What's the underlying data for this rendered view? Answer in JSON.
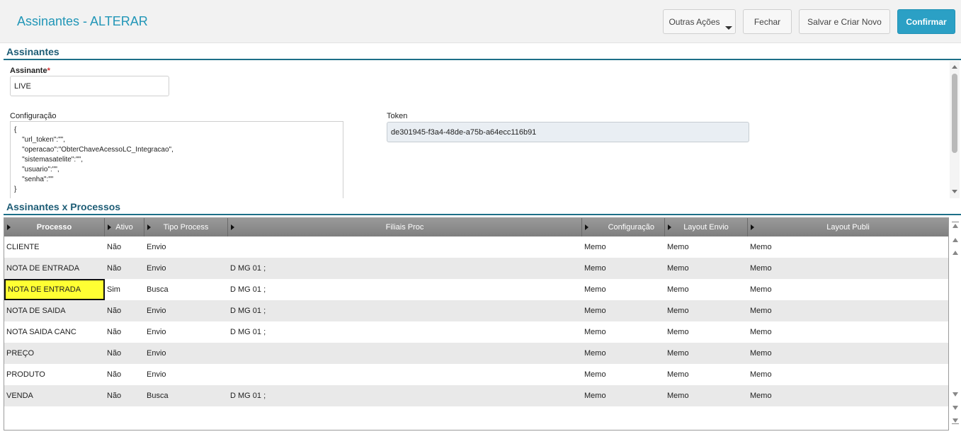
{
  "header": {
    "title": "Assinantes - ALTERAR",
    "buttons": {
      "outras_acoes": "Outras Ações",
      "fechar": "Fechar",
      "salvar_criar_novo": "Salvar e Criar Novo",
      "confirmar": "Confirmar"
    }
  },
  "section_assinantes": {
    "title": "Assinantes",
    "assinante_label": "Assinante",
    "required_mark": "*",
    "assinante_value": "LIVE",
    "configuracao_label": "Configuração",
    "configuracao_value": "{\n    \"url_token\":\"\",\n    \"operacao\":\"ObterChaveAcessoLC_Integracao\",\n    \"sistemasatelite\":\"\",\n    \"usuario\":\"\",\n    \"senha\":\"\"\n}",
    "token_label": "Token",
    "token_value": "de301945-f3a4-48de-a75b-a64ecc116b91"
  },
  "section_processos": {
    "title": "Assinantes x Processos",
    "columns": [
      "Processo",
      "Ativo",
      "Tipo Process",
      "Filiais Proc",
      "Configuração",
      "Layout Envio",
      "Layout Publi"
    ],
    "rows": [
      [
        "CLIENTE",
        "Não",
        "Envio",
        "",
        "Memo",
        "Memo",
        "Memo"
      ],
      [
        "NOTA DE ENTRADA",
        "Não",
        "Envio",
        "D MG 01 ;",
        "Memo",
        "Memo",
        "Memo"
      ],
      [
        "NOTA DE ENTRADA",
        "Sim",
        "Busca",
        "D MG 01 ;",
        "Memo",
        "Memo",
        "Memo"
      ],
      [
        "NOTA DE SAIDA",
        "Não",
        "Envio",
        "D MG 01 ;",
        "Memo",
        "Memo",
        "Memo"
      ],
      [
        "NOTA SAIDA CANC",
        "Não",
        "Envio",
        "D MG 01 ;",
        "Memo",
        "Memo",
        "Memo"
      ],
      [
        "PREÇO",
        "Não",
        "Envio",
        "",
        "Memo",
        "Memo",
        "Memo"
      ],
      [
        "PRODUTO",
        "Não",
        "Envio",
        "",
        "Memo",
        "Memo",
        "Memo"
      ],
      [
        "VENDA",
        "Não",
        "Busca",
        "D MG 01 ;",
        "Memo",
        "Memo",
        "Memo"
      ]
    ],
    "selected_row": 2
  },
  "colors": {
    "accent": "#2196b7",
    "confirm_button": "#2ba0c5",
    "section_title": "#1d5c75",
    "selected_cell": "#ffff33"
  }
}
